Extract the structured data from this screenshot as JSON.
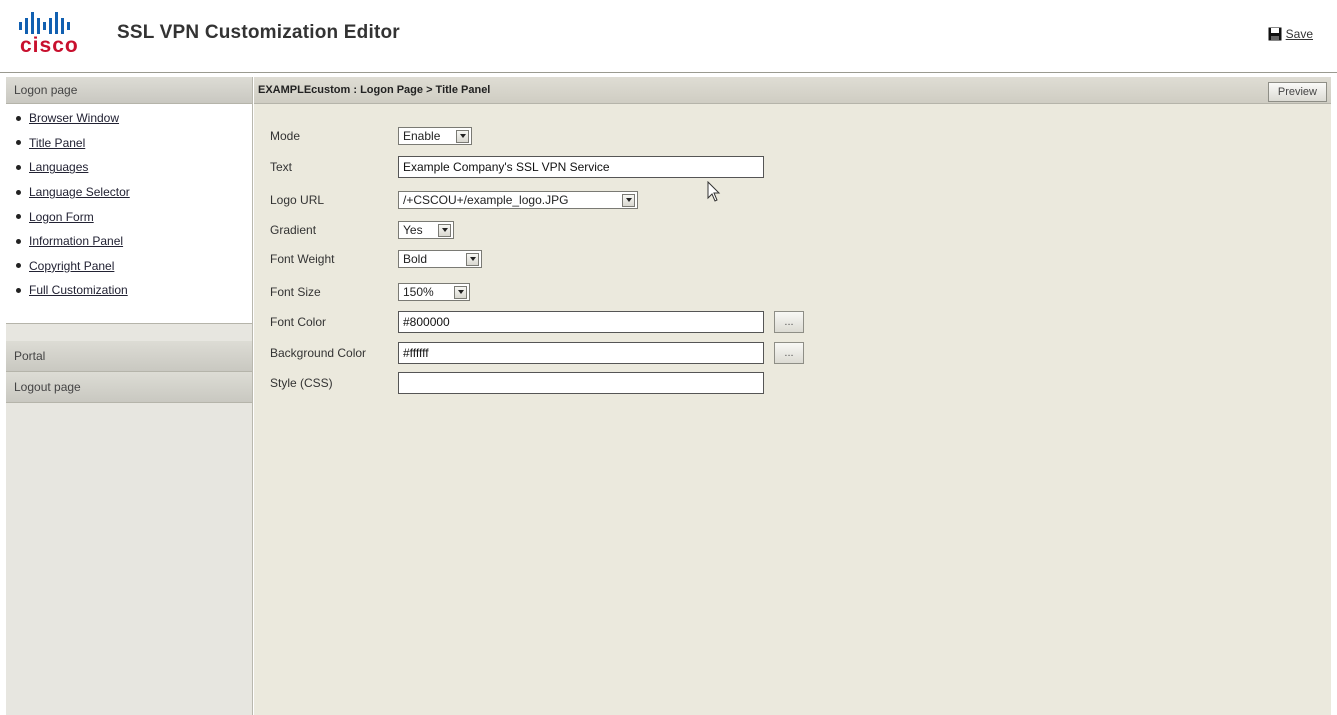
{
  "header": {
    "logo_text": "cisco",
    "title": "SSL VPN Customization Editor",
    "save_label": "Save"
  },
  "sidebar": {
    "logon_header": "Logon page",
    "logon_items": [
      {
        "label": "Browser Window"
      },
      {
        "label": "Title Panel"
      },
      {
        "label": "Languages"
      },
      {
        "label": "Language Selector"
      },
      {
        "label": "Logon Form"
      },
      {
        "label": "Information Panel"
      },
      {
        "label": "Copyright Panel"
      },
      {
        "label": "Full Customization"
      }
    ],
    "portal_header": "Portal",
    "logout_header": "Logout page"
  },
  "main": {
    "breadcrumb": "EXAMPLEcustom : Logon Page > Title Panel",
    "preview_label": "Preview",
    "form": {
      "mode": {
        "label": "Mode",
        "value": "Enable"
      },
      "text": {
        "label": "Text",
        "value": "Example Company's SSL VPN Service"
      },
      "logo_url": {
        "label": "Logo URL",
        "value": "/+CSCOU+/example_logo.JPG"
      },
      "gradient": {
        "label": "Gradient",
        "value": "Yes"
      },
      "font_weight": {
        "label": "Font Weight",
        "value": "Bold"
      },
      "font_size": {
        "label": "Font Size",
        "value": "150%"
      },
      "font_color": {
        "label": "Font Color",
        "value": "#800000",
        "button": "..."
      },
      "background_color": {
        "label": "Background Color",
        "value": "#ffffff",
        "button": "..."
      },
      "style_css": {
        "label": "Style (CSS)",
        "value": ""
      }
    }
  },
  "colors": {
    "brand_logo": "#0a4fa2",
    "main_bg": "#ebe9dd",
    "sidebar_bg": "#e7e6e0"
  }
}
